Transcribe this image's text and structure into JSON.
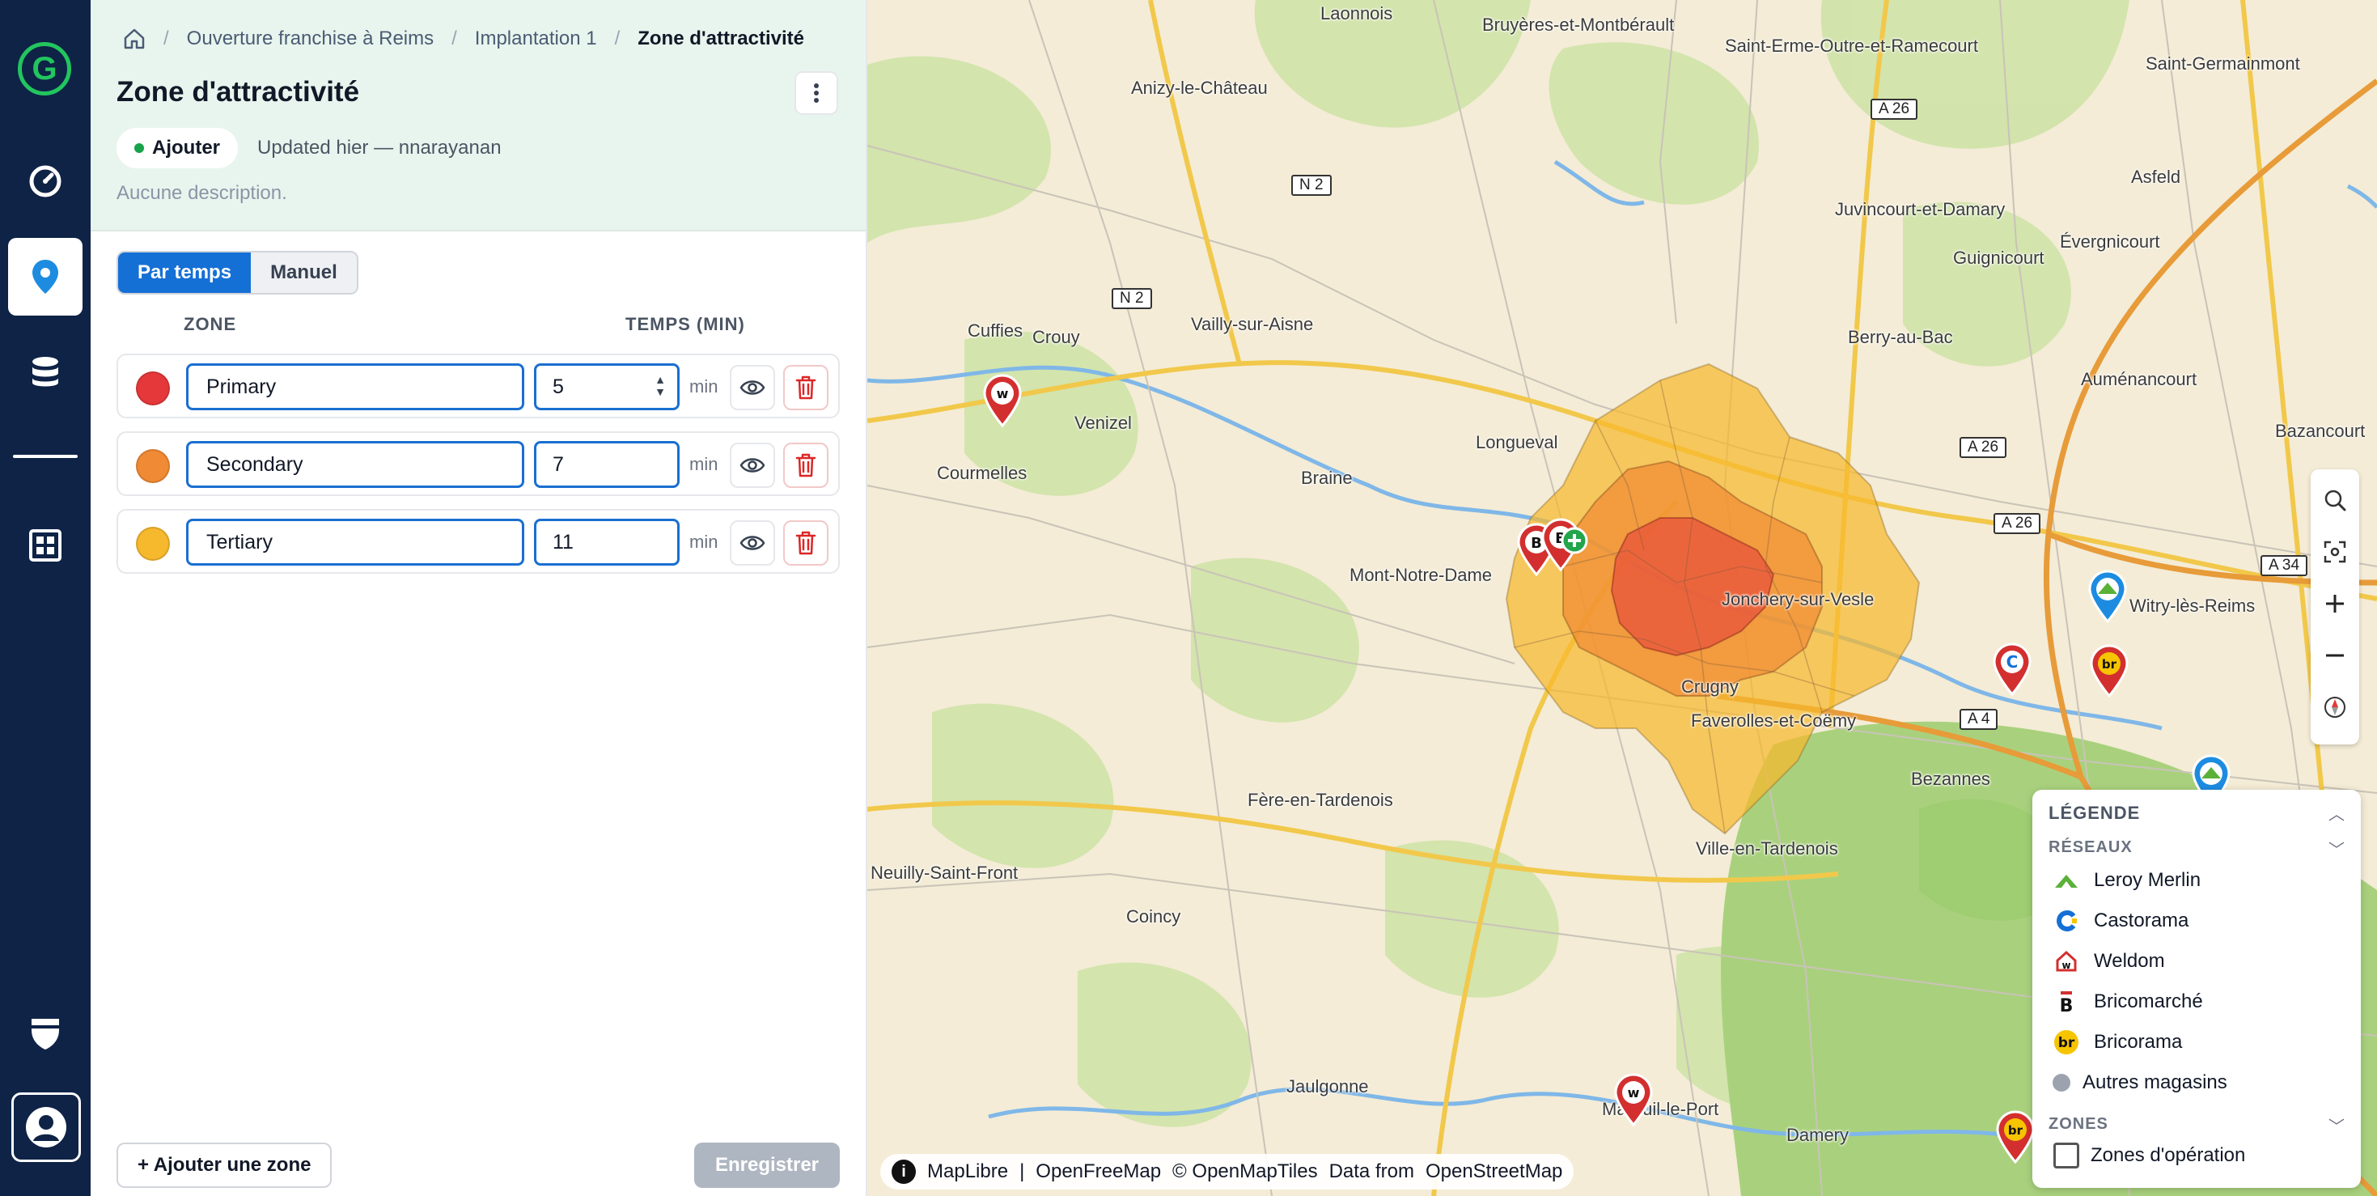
{
  "app": {
    "logo_letter": "G"
  },
  "breadcrumb": {
    "items": [
      "Ouverture franchise à Reims",
      "Implantation 1",
      "Zone d'attractivité"
    ]
  },
  "header": {
    "title": "Zone d'attractivité",
    "status_label": "Ajouter",
    "updated": "Updated hier — nnarayanan",
    "description": "Aucune description."
  },
  "mode_toggle": {
    "options": [
      "Par temps",
      "Manuel"
    ],
    "selected": "Par temps"
  },
  "zones_table": {
    "headers": {
      "zone": "ZONE",
      "time": "TEMPS (MIN)"
    },
    "unit": "min",
    "rows": [
      {
        "name": "Primary",
        "minutes": "5",
        "color": "#e5383b"
      },
      {
        "name": "Secondary",
        "minutes": "7",
        "color": "#f08a34"
      },
      {
        "name": "Tertiary",
        "minutes": "11",
        "color": "#f6b82d"
      }
    ]
  },
  "actions": {
    "add_zone": "+ Ajouter une zone",
    "save": "Enregistrer"
  },
  "map": {
    "attribution": {
      "maplibre": "MapLibre",
      "sep": "|",
      "openfreemap": "OpenFreeMap",
      "copyright": "© OpenMapTiles",
      "data_from": "Data from",
      "osm": "OpenStreetMap"
    },
    "places": [
      "Laonnois",
      "Bruyères-et-Montbérault",
      "Saint-Erme-Outre-et-Ramecourt",
      "Saint-Germainmont",
      "Anizy-le-Château",
      "Asfeld",
      "Juvincourt-et-Damary",
      "Évergnicourt",
      "Guignicourt",
      "Cuffies",
      "Crouy",
      "Vailly-sur-Aisne",
      "Berry-au-Bac",
      "Auménancourt",
      "Venizel",
      "Bazancourt",
      "Courmelles",
      "Longueval",
      "Braine",
      "Mont-Notre-Dame",
      "Jonchery-sur-Vesle",
      "Witry-lès-Reims",
      "Crugny",
      "Faverolles-et-Coëmy",
      "Bezannes",
      "Fère-en-Tardenois",
      "Ville-en-Tardenois",
      "Neuilly-Saint-Front",
      "Coincy",
      "Jaulgonne",
      "Mareuil-le-Port",
      "Damery"
    ],
    "roads": [
      "A 26",
      "N 2",
      "N 2",
      "A 26",
      "A 26",
      "A 34",
      "A 4"
    ],
    "legend": {
      "title": "LÉGENDE",
      "networks_title": "RÉSEAUX",
      "networks": [
        {
          "label": "Leroy Merlin",
          "icon": "leroy-merlin-icon"
        },
        {
          "label": "Castorama",
          "icon": "castorama-icon"
        },
        {
          "label": "Weldom",
          "icon": "weldom-icon"
        },
        {
          "label": "Bricomarché",
          "icon": "bricomarche-icon"
        },
        {
          "label": "Bricorama",
          "icon": "bricorama-icon"
        },
        {
          "label": "Autres magasins",
          "icon": "other-store-icon"
        }
      ],
      "zones_title": "ZONES",
      "zones": [
        {
          "label": "Zones d'opération",
          "checked": false
        }
      ]
    }
  },
  "colors": {
    "accent": "#1570d6",
    "rail": "#0e2346",
    "header_bg": "#e8f5ee",
    "brand_green": "#22c55e"
  }
}
